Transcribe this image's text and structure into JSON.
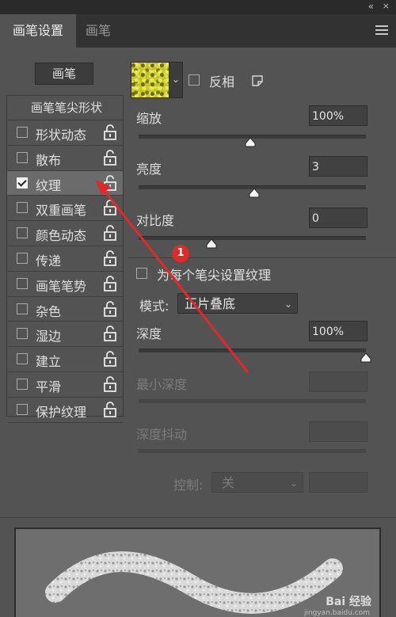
{
  "tabs": {
    "active": "画笔设置",
    "inactive": "画笔"
  },
  "topbar": {
    "collapse_glyph": "«",
    "close_glyph": "×"
  },
  "brush_button": "画笔",
  "list": {
    "header": "画笔笔尖形状",
    "items": [
      {
        "label": "形状动态",
        "checked": false
      },
      {
        "label": "散布",
        "checked": false
      },
      {
        "label": "纹理",
        "checked": true,
        "selected": true
      },
      {
        "label": "双重画笔",
        "checked": false
      },
      {
        "label": "颜色动态",
        "checked": false
      },
      {
        "label": "传递",
        "checked": false
      },
      {
        "label": "画笔笔势",
        "checked": false
      },
      {
        "label": "杂色",
        "checked": false
      },
      {
        "label": "湿边",
        "checked": false
      },
      {
        "label": "建立",
        "checked": false
      },
      {
        "label": "平滑",
        "checked": false
      },
      {
        "label": "保护纹理",
        "checked": false
      }
    ]
  },
  "texture": {
    "invert_label": "反相",
    "scale": {
      "label": "缩放",
      "value": "100%",
      "slider": 0.49
    },
    "brightness": {
      "label": "亮度",
      "value": "3",
      "slider": 0.51
    },
    "contrast": {
      "label": "对比度",
      "value": "0",
      "slider": 0.32
    },
    "per_tip_label": "为每个笔尖设置纹理",
    "mode": {
      "label": "模式:",
      "value": "正片叠底",
      "chevron": "⌄"
    },
    "depth": {
      "label": "深度",
      "value": "100%",
      "slider": 1.0
    },
    "min_depth": {
      "label": "最小深度",
      "value": ""
    },
    "depth_jitter": {
      "label": "深度抖动",
      "value": ""
    },
    "control": {
      "label": "控制:",
      "value": "关",
      "chevron": "⌄"
    }
  },
  "annotation": {
    "badge": "1",
    "color": "#e02a2a"
  },
  "watermark": {
    "brand": "Bai 经验",
    "url": "jingyan.baidu.com"
  }
}
